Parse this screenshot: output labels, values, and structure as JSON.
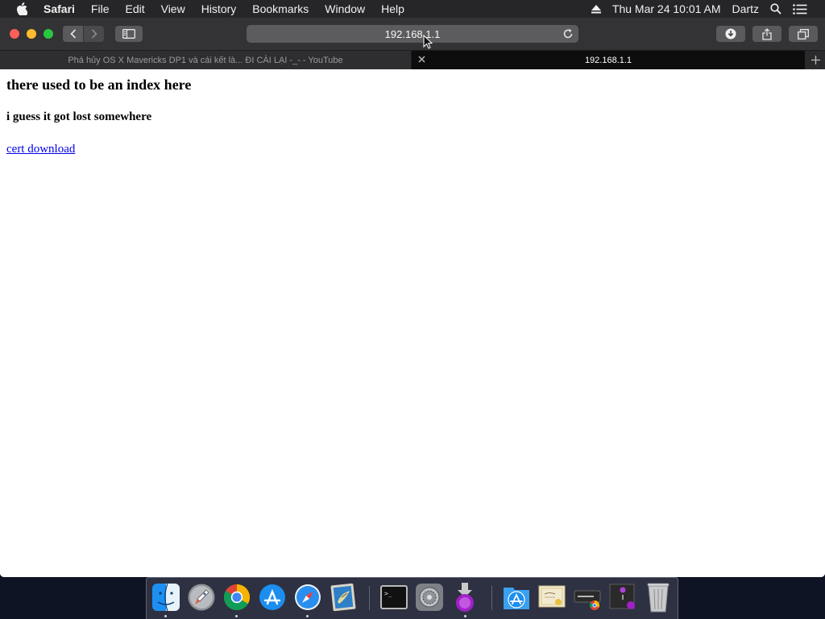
{
  "menubar": {
    "items": [
      "Safari",
      "File",
      "Edit",
      "View",
      "History",
      "Bookmarks",
      "Window",
      "Help"
    ],
    "datetime": "Thu Mar 24  10:01 AM",
    "user": "Dartz"
  },
  "browser": {
    "address": "192.168.1.1",
    "tabs": [
      {
        "title": "Phá hủy OS X Mavericks DP1 và cái kết là... ĐI CÀI LẠI -_- - YouTube",
        "active": false
      },
      {
        "title": "192.168.1.1",
        "active": true
      }
    ]
  },
  "page": {
    "heading": "there used to be an index here",
    "subheading": "i guess it got lost somewhere",
    "link": "cert download"
  },
  "dock": {
    "apps": [
      "finder-icon",
      "launchpad-icon",
      "chrome-icon",
      "app-store-icon",
      "safari-icon",
      "preview-icon",
      "terminal-icon",
      "system-preferences-icon",
      "installer-icon",
      "applications-folder-icon",
      "certificate-icon",
      "chrome-installer-icon",
      "installer-package-icon",
      "trash-icon"
    ]
  }
}
